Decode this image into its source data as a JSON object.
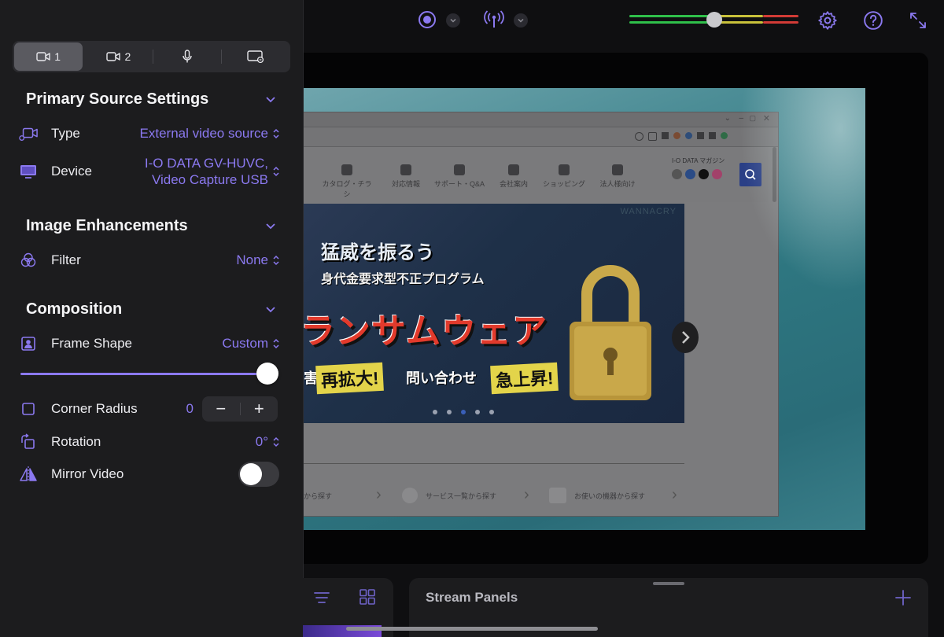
{
  "toolbar": {
    "record_icon": "record-icon",
    "broadcast_icon": "broadcast-icon",
    "settings_icon": "gear-icon",
    "help_icon": "question-icon",
    "expand_icon": "expand-icon"
  },
  "audio_meter": {
    "level": 0.5
  },
  "preview": {
    "web_nav": [
      "カタログ・チラシ",
      "対応情報",
      "サポート・Q&A",
      "会社案内",
      "ショッピング",
      "法人様向け"
    ],
    "web_brand": "I-O DATA マガジン",
    "banner_lines": [
      "猛威を振るう",
      "身代金要求型不正プログラム",
      "ランサムウェア"
    ],
    "banner_tags": [
      "再拡大!",
      "問い合わせ",
      "急上昇!"
    ],
    "banner_fragment": "害",
    "banner_watermark": "WANNACRY",
    "list_items": [
      "から探す",
      "サービス一覧から探す",
      "お使いの機器から探す"
    ]
  },
  "source_tabs": [
    {
      "label": "1",
      "icon": "video-camera-icon",
      "selected": true
    },
    {
      "label": "2",
      "icon": "video-camera-icon",
      "selected": false
    },
    {
      "label": "",
      "icon": "microphone-icon",
      "selected": false
    },
    {
      "label": "",
      "icon": "screen-overlay-icon",
      "selected": false
    }
  ],
  "sections": {
    "primary": {
      "title": "Primary Source Settings",
      "type_label": "Type",
      "type_value": "External video source",
      "device_label": "Device",
      "device_value_line1": "I-O DATA GV-HUVC,",
      "device_value_line2": "Video Capture USB"
    },
    "enhancements": {
      "title": "Image Enhancements",
      "filter_label": "Filter",
      "filter_value": "None"
    },
    "composition": {
      "title": "Composition",
      "frame_shape_label": "Frame Shape",
      "frame_shape_value": "Custom",
      "frame_slider_value": 1.0,
      "corner_radius_label": "Corner Radius",
      "corner_radius_value": "0",
      "stepper_minus": "−",
      "stepper_plus": "+",
      "rotation_label": "Rotation",
      "rotation_value": "0°",
      "mirror_label": "Mirror Video",
      "mirror_on": false
    }
  },
  "bottom": {
    "stream_panels_title": "Stream Panels",
    "list_icon": "list-icon",
    "grid_icon": "grid-icon",
    "add_icon": "plus-icon"
  },
  "colors": {
    "accent": "#8b79f0",
    "panel_bg": "#1c1c1e",
    "meter_green": "#2fbf4a",
    "meter_yellow": "#c8c03a",
    "meter_red": "#d23b36"
  }
}
